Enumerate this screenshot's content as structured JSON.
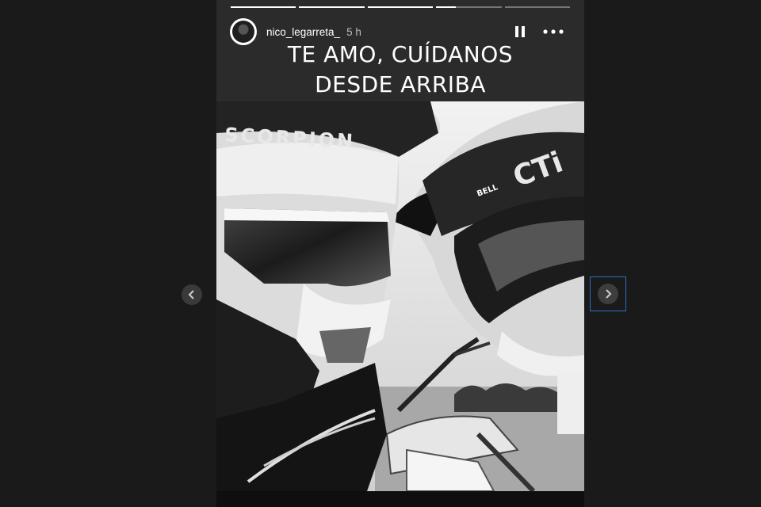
{
  "story": {
    "segments": [
      {
        "progress": 1.0
      },
      {
        "progress": 1.0
      },
      {
        "progress": 1.0
      },
      {
        "progress": 0.3
      },
      {
        "progress": 0.0
      }
    ],
    "user": {
      "username": "nico_legarreta_",
      "time_ago": "5 h"
    },
    "caption": {
      "line1": "TE AMO, CUÍDANOS",
      "line2": "DESDE ARRIBA"
    },
    "photo": {
      "helmet_left_brand": "SCORPION",
      "helmet_right_brand": "CTi",
      "helmet_right_badge": "BELL"
    }
  },
  "icons": {
    "pause": "pause-icon",
    "more": "more-horizontal-icon",
    "prev": "chevron-left-icon",
    "next": "chevron-right-icon"
  },
  "colors": {
    "page_background": "#1a1a1a",
    "focus_outline": "#2f6fbf"
  }
}
